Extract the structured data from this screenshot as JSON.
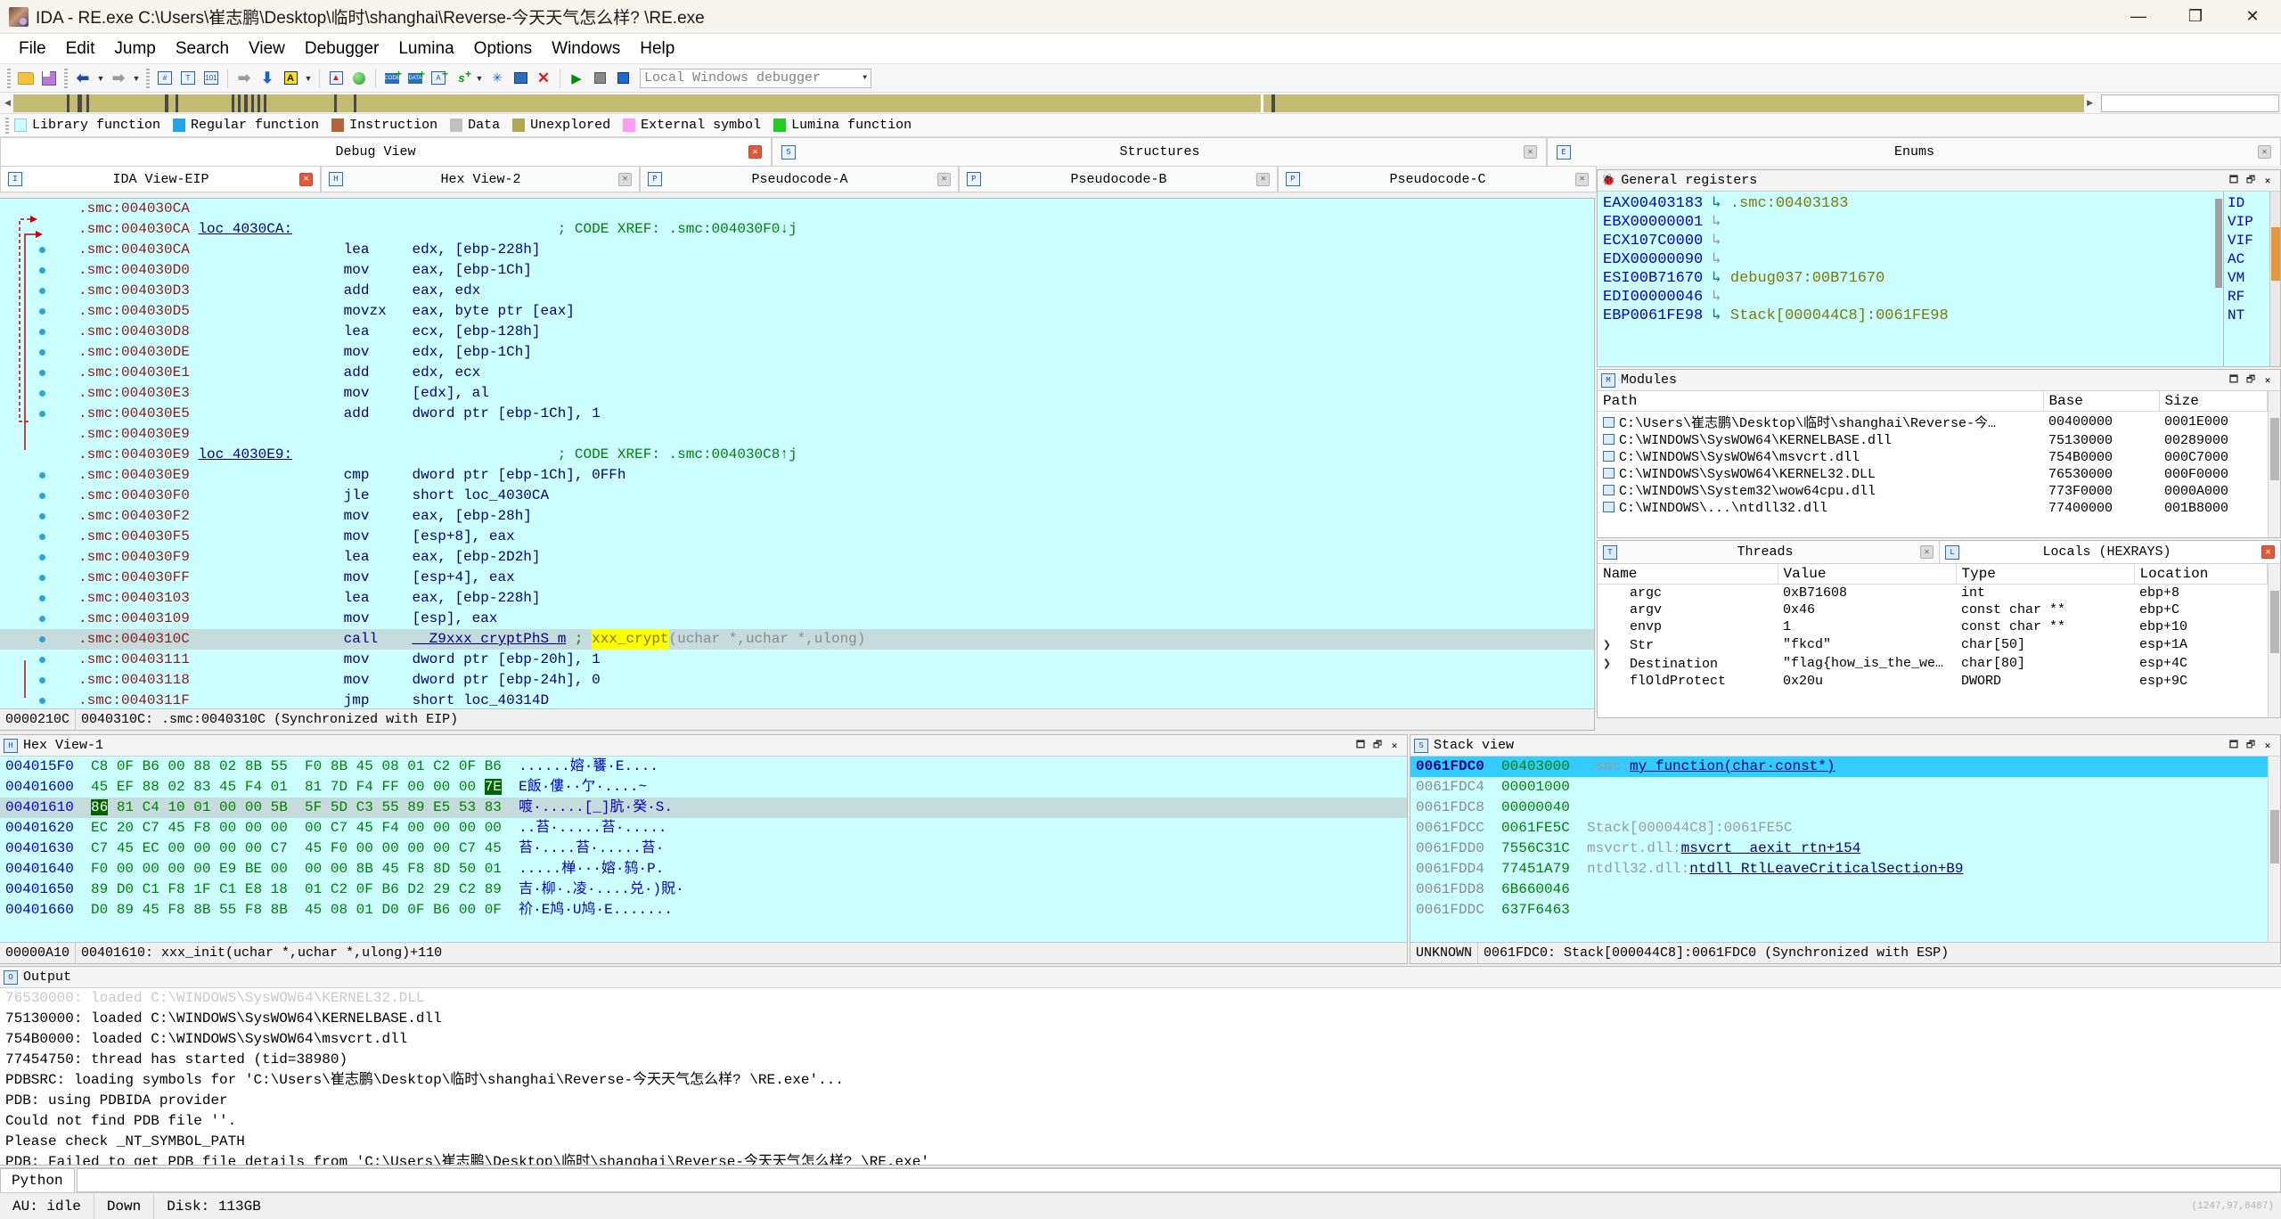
{
  "window": {
    "title": "IDA - RE.exe C:\\Users\\崔志鹏\\Desktop\\临时\\shanghai\\Reverse-今天天气怎么样? \\RE.exe",
    "minimize": "—",
    "maximize": "❐",
    "close": "✕"
  },
  "menu": [
    "File",
    "Edit",
    "Jump",
    "Search",
    "View",
    "Debugger",
    "Lumina",
    "Options",
    "Windows",
    "Help"
  ],
  "toolbar": {
    "debugger_selected": "Local Windows debugger",
    "caret": "▼"
  },
  "legend": [
    {
      "label": "Library function",
      "color": "#ccffff"
    },
    {
      "label": "Regular function",
      "color": "#22a5e8"
    },
    {
      "label": "Instruction",
      "color": "#b5653a"
    },
    {
      "label": "Data",
      "color": "#c0c0c0"
    },
    {
      "label": "Unexplored",
      "color": "#b0a84c"
    },
    {
      "label": "External symbol",
      "color": "#ff9cf0"
    },
    {
      "label": "Lumina function",
      "color": "#22cc22"
    }
  ],
  "top_tabs": [
    {
      "label": "Debug View",
      "close": "✕",
      "active": true
    },
    {
      "label": "Structures",
      "close": "✕",
      "active": false
    },
    {
      "label": "Enums",
      "close": "✕",
      "active": false
    }
  ],
  "sub_tabs": [
    {
      "label": "IDA View-EIP",
      "close": "✕",
      "active": true
    },
    {
      "label": "Hex View-2",
      "close": "✕",
      "active": false
    },
    {
      "label": "Pseudocode-A",
      "close": "✕",
      "active": false
    },
    {
      "label": "Pseudocode-B",
      "close": "✕",
      "active": false
    },
    {
      "label": "Pseudocode-C",
      "close": "✕",
      "active": false
    }
  ],
  "disassembly": {
    "lines": [
      {
        "addr": ".smc:004030CA",
        "label": "",
        "mn": "",
        "op": "",
        "comment": "",
        "bp": false,
        "hl": false
      },
      {
        "addr": ".smc:004030CA",
        "label": "loc_4030CA:",
        "mn": "",
        "op": "",
        "comment": "; CODE XREF: .smc:004030F0↓j",
        "bp": false,
        "hl": false
      },
      {
        "addr": ".smc:004030CA",
        "label": "",
        "mn": "lea",
        "op": "edx, [ebp-228h]",
        "comment": "",
        "bp": true,
        "hl": false
      },
      {
        "addr": ".smc:004030D0",
        "label": "",
        "mn": "mov",
        "op": "eax, [ebp-1Ch]",
        "comment": "",
        "bp": true,
        "hl": false
      },
      {
        "addr": ".smc:004030D3",
        "label": "",
        "mn": "add",
        "op": "eax, edx",
        "comment": "",
        "bp": true,
        "hl": false
      },
      {
        "addr": ".smc:004030D5",
        "label": "",
        "mn": "movzx",
        "op": "eax, byte ptr [eax]",
        "comment": "",
        "bp": true,
        "hl": false
      },
      {
        "addr": ".smc:004030D8",
        "label": "",
        "mn": "lea",
        "op": "ecx, [ebp-128h]",
        "comment": "",
        "bp": true,
        "hl": false
      },
      {
        "addr": ".smc:004030DE",
        "label": "",
        "mn": "mov",
        "op": "edx, [ebp-1Ch]",
        "comment": "",
        "bp": true,
        "hl": false
      },
      {
        "addr": ".smc:004030E1",
        "label": "",
        "mn": "add",
        "op": "edx, ecx",
        "comment": "",
        "bp": true,
        "hl": false
      },
      {
        "addr": ".smc:004030E3",
        "label": "",
        "mn": "mov",
        "op": "[edx], al",
        "comment": "",
        "bp": true,
        "hl": false
      },
      {
        "addr": ".smc:004030E5",
        "label": "",
        "mn": "add",
        "op": "dword ptr [ebp-1Ch], 1",
        "comment": "",
        "bp": true,
        "hl": false
      },
      {
        "addr": ".smc:004030E9",
        "label": "",
        "mn": "",
        "op": "",
        "comment": "",
        "bp": false,
        "hl": false
      },
      {
        "addr": ".smc:004030E9",
        "label": "loc_4030E9:",
        "mn": "",
        "op": "",
        "comment": "; CODE XREF: .smc:004030C8↑j",
        "bp": false,
        "hl": false
      },
      {
        "addr": ".smc:004030E9",
        "label": "",
        "mn": "cmp",
        "op": "dword ptr [ebp-1Ch], 0FFh",
        "comment": "",
        "bp": true,
        "hl": false
      },
      {
        "addr": ".smc:004030F0",
        "label": "",
        "mn": "jle",
        "op": "short loc_4030CA",
        "comment": "",
        "bp": true,
        "hl": false
      },
      {
        "addr": ".smc:004030F2",
        "label": "",
        "mn": "mov",
        "op": "eax, [ebp-28h]",
        "comment": "",
        "bp": true,
        "hl": false
      },
      {
        "addr": ".smc:004030F5",
        "label": "",
        "mn": "mov",
        "op": "[esp+8], eax",
        "comment": "",
        "bp": true,
        "hl": false
      },
      {
        "addr": ".smc:004030F9",
        "label": "",
        "mn": "lea",
        "op": "eax, [ebp-2D2h]",
        "comment": "",
        "bp": true,
        "hl": false
      },
      {
        "addr": ".smc:004030FF",
        "label": "",
        "mn": "mov",
        "op": "[esp+4], eax",
        "comment": "",
        "bp": true,
        "hl": false
      },
      {
        "addr": ".smc:00403103",
        "label": "",
        "mn": "lea",
        "op": "eax, [ebp-228h]",
        "comment": "",
        "bp": true,
        "hl": false
      },
      {
        "addr": ".smc:00403109",
        "label": "",
        "mn": "mov",
        "op": "[esp], eax",
        "comment": "",
        "bp": true,
        "hl": false
      },
      {
        "addr": ".smc:0040310C",
        "label": "",
        "mn": "call",
        "op": "__Z9xxx_cryptPhS_m",
        "comment": "; xxx_crypt(uchar *,uchar *,ulong)",
        "bp": true,
        "hl": true,
        "call_sym": "__Z9xxx_cryptPhS_m",
        "call_hl": "xxx_crypt",
        "call_args": "(uchar *,uchar *,ulong)"
      },
      {
        "addr": ".smc:00403111",
        "label": "",
        "mn": "mov",
        "op": "dword ptr [ebp-20h], 1",
        "comment": "",
        "bp": true,
        "hl": false
      },
      {
        "addr": ".smc:00403118",
        "label": "",
        "mn": "mov",
        "op": "dword ptr [ebp-24h], 0",
        "comment": "",
        "bp": true,
        "hl": false
      },
      {
        "addr": ".smc:0040311F",
        "label": "",
        "mn": "jmp",
        "op": "short loc_40314D",
        "comment": "",
        "bp": true,
        "hl": false
      }
    ],
    "status": [
      "0000210C",
      "0040310C: .smc:0040310C (Synchronized with EIP)"
    ]
  },
  "registers": {
    "title": "General registers",
    "rows": [
      {
        "name": "EAX",
        "value": "00403183",
        "arrow": "↳",
        "ref": ".smc:00403183",
        "dim": false
      },
      {
        "name": "EBX",
        "value": "00000001",
        "arrow": "↳",
        "ref": "",
        "dim": true
      },
      {
        "name": "ECX",
        "value": "107C0000",
        "arrow": "↳",
        "ref": "",
        "dim": true
      },
      {
        "name": "EDX",
        "value": "00000090",
        "arrow": "↳",
        "ref": "",
        "dim": true
      },
      {
        "name": "ESI",
        "value": "00B71670",
        "arrow": "↳",
        "ref": "debug037:00B71670",
        "dim": false
      },
      {
        "name": "EDI",
        "value": "00000046",
        "arrow": "↳",
        "ref": "",
        "dim": true
      },
      {
        "name": "EBP",
        "value": "0061FE98",
        "arrow": "↳",
        "ref": "Stack[000044C8]:0061FE98",
        "dim": false
      }
    ],
    "flags": [
      "ID",
      "VIP",
      "VIF",
      "AC",
      "VM",
      "RF",
      "NT"
    ]
  },
  "modules": {
    "title": "Modules",
    "columns": [
      "Path",
      "Base",
      "Size"
    ],
    "rows": [
      {
        "path": "C:\\Users\\崔志鹏\\Desktop\\临时\\shanghai\\Reverse-今…",
        "base": "00400000",
        "size": "0001E000"
      },
      {
        "path": "C:\\WINDOWS\\SysWOW64\\KERNELBASE.dll",
        "base": "75130000",
        "size": "00289000"
      },
      {
        "path": "C:\\WINDOWS\\SysWOW64\\msvcrt.dll",
        "base": "754B0000",
        "size": "000C7000"
      },
      {
        "path": "C:\\WINDOWS\\SysWOW64\\KERNEL32.DLL",
        "base": "76530000",
        "size": "000F0000"
      },
      {
        "path": "C:\\WINDOWS\\System32\\wow64cpu.dll",
        "base": "773F0000",
        "size": "0000A000"
      },
      {
        "path": "C:\\WINDOWS\\...\\ntdll32.dll",
        "base": "77400000",
        "size": "001B8000"
      }
    ]
  },
  "locals": {
    "threads_tab": "Threads",
    "locals_tab": "Locals  (HEXRAYS)",
    "columns": [
      "Name",
      "Value",
      "Type",
      "Location"
    ],
    "rows": [
      {
        "expand": "",
        "name": "argc",
        "value": "0xB71608",
        "type": "int",
        "location": "ebp+8"
      },
      {
        "expand": "",
        "name": "argv",
        "value": "0x46",
        "type": "const char **",
        "location": "ebp+C"
      },
      {
        "expand": "",
        "name": "envp",
        "value": "1",
        "type": "const char **",
        "location": "ebp+10"
      },
      {
        "expand": "❯",
        "name": "Str",
        "value": "\"fkcd\"",
        "type": "char[50]",
        "location": "esp+1A"
      },
      {
        "expand": "❯",
        "name": "Destination",
        "value": "\"flag{how_is_the_we…",
        "type": "char[80]",
        "location": "esp+4C"
      },
      {
        "expand": "",
        "name": "flOldProtect",
        "value": "0x20u",
        "type": "DWORD",
        "location": "esp+9C"
      }
    ]
  },
  "hexview": {
    "title": "Hex View-1",
    "rows": [
      {
        "addr": "004015F0",
        "bytes": "C8 0F B6 00 88 02 8B 55  F0 8B 45 08 01 C2 0F B6",
        "ascii": "......嫆·饔·E....",
        "hl": false
      },
      {
        "addr": "00401600",
        "bytes": "45 EF 88 02 83 45 F4 01  81 7D F4 FF 00 00 00 ",
        "bytes_sel": "7E",
        "ascii": "E飯·僂··亇·....~",
        "hl": false
      },
      {
        "addr": "00401610",
        "bytes_sel": "86",
        "bytes_after": " 81 C4 10 01 00 00 5B  5F 5D C3 55 89 E5 53 83",
        "ascii": "喥·.....[_]肮·癸·S.",
        "hl": true
      },
      {
        "addr": "00401620",
        "bytes": "EC 20 C7 45 F8 00 00 00  00 C7 45 F4 00 00 00 00",
        "ascii": "..苔·.....苔·.....",
        "hl": false
      },
      {
        "addr": "00401630",
        "bytes": "C7 45 EC 00 00 00 00 C7  45 F0 00 00 00 00 C7 45",
        "ascii": "苔·....苔·.....苔·",
        "hl": false
      },
      {
        "addr": "00401640",
        "bytes": "F0 00 00 00 00 E9 BE 00  00 00 8B 45 F8 8D 50 01",
        "ascii": ".....椫···嫆·鸫·P.",
        "hl": false
      },
      {
        "addr": "00401650",
        "bytes": "89 D0 C1 F8 1F C1 E8 18  01 C2 0F B6 D2 29 C2 89",
        "ascii": "吉·柳·.凌·....兑·)貺·",
        "hl": false
      },
      {
        "addr": "00401660",
        "bytes": "D0 89 45 F8 8B 55 F8 8B  45 08 01 D0 0F B6 00 0F",
        "ascii": "祄·E鸠·U鸠·E.......",
        "hl": false
      }
    ],
    "status": [
      "00000A10",
      "00401610: xxx_init(uchar *,uchar *,ulong)+110"
    ]
  },
  "stackview": {
    "title": "Stack view",
    "rows": [
      {
        "addr": "0061FDC0",
        "value": "00403000",
        "mod": ".smc:",
        "sym": "my_function(char·const*)",
        "hl": true
      },
      {
        "addr": "0061FDC4",
        "value": "00001000",
        "mod": "",
        "sym": "",
        "hl": false
      },
      {
        "addr": "0061FDC8",
        "value": "00000040",
        "mod": "",
        "sym": "",
        "hl": false
      },
      {
        "addr": "0061FDCC",
        "value": "0061FE5C",
        "mod": "Stack[000044C8]:0061FE5C",
        "sym": "",
        "hl": false
      },
      {
        "addr": "0061FDD0",
        "value": "7556C31C",
        "mod": "msvcrt.dll:",
        "sym": "msvcrt__aexit_rtn+154",
        "hl": false
      },
      {
        "addr": "0061FDD4",
        "value": "77451A79",
        "mod": "ntdll32.dll:",
        "sym": "ntdll_RtlLeaveCriticalSection+B9",
        "hl": false
      },
      {
        "addr": "0061FDD8",
        "value": "6B660046",
        "mod": "",
        "sym": "",
        "hl": false
      },
      {
        "addr": "0061FDDC",
        "value": "637F6463",
        "mod": "",
        "sym": "",
        "hl": false
      }
    ],
    "status": [
      "UNKNOWN",
      "0061FDC0: Stack[000044C8]:0061FDC0 (Synchronized with ESP)"
    ]
  },
  "output": {
    "title": "Output",
    "lines": [
      "76530000: loaded C:\\WINDOWS\\SysWOW64\\KERNEL32.DLL",
      "75130000: loaded C:\\WINDOWS\\SysWOW64\\KERNELBASE.dll",
      "754B0000: loaded C:\\WINDOWS\\SysWOW64\\msvcrt.dll",
      "77454750: thread has started (tid=38980)",
      "PDBSRC: loading symbols for 'C:\\Users\\崔志鹏\\Desktop\\临时\\shanghai\\Reverse-今天天气怎么样? \\RE.exe'...",
      "PDB: using PDBIDA provider",
      "Could not find PDB file ''.",
      "Please check _NT_SYMBOL_PATH",
      "PDB: Failed to get PDB file details from 'C:\\Users\\崔志鹏\\Desktop\\临时\\shanghai\\Reverse-今天天气怎么样? \\RE.exe'"
    ]
  },
  "cli": {
    "tab": "Python",
    "value": ""
  },
  "statusbar": {
    "au": "AU:  idle",
    "down": "Down",
    "disk": "Disk: 113GB",
    "right": "(1247,97,8487)"
  }
}
